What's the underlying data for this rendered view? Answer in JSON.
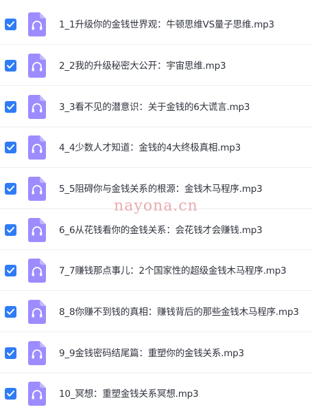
{
  "colors": {
    "checkbox": "#2f7cf6",
    "file_icon": "#9d8cff",
    "text": "#2f333d",
    "divider": "#eceef2",
    "watermark": "#e8a3a8"
  },
  "file_icon_name": "headphones-file-icon",
  "files": [
    {
      "name": "1_1升级你的金钱世界观：牛顿思维VS量子思维.mp3",
      "checked": true
    },
    {
      "name": "2_2我的升级秘密大公开：宇宙思维.mp3",
      "checked": true
    },
    {
      "name": "3_3看不见的潜意识：关于金钱的6大谎言.mp3",
      "checked": true
    },
    {
      "name": "4_4少数人才知道：金钱的4大终极真相.mp3",
      "checked": true
    },
    {
      "name": "5_5阻碍你与金钱关系的根源：金钱木马程序.mp3",
      "checked": true
    },
    {
      "name": "6_6从花钱看你的金钱关系：会花钱才会赚钱.mp3",
      "checked": true
    },
    {
      "name": "7_7赚钱那点事儿：2个国家性的超级金钱木马程序.mp3",
      "checked": true
    },
    {
      "name": "8_8你赚不到钱的真相：赚钱背后的那些金钱木马程序.mp3",
      "checked": true
    },
    {
      "name": "9_9金钱密码结尾篇：重塑你的金钱关系.mp3",
      "checked": true
    },
    {
      "name": "10_冥想：重塑金钱关系冥想.mp3",
      "checked": true
    }
  ],
  "watermark": "nayona.cn"
}
